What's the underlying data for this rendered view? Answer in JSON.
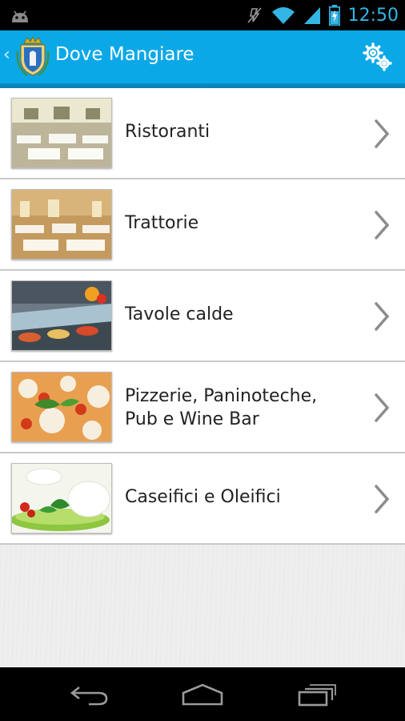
{
  "status_bar": {
    "time": "12:50",
    "icons": [
      "android-icon",
      "silent-icon",
      "wifi-icon",
      "signal-icon",
      "battery-charging-icon"
    ]
  },
  "action_bar": {
    "title": "Dove Mangiare",
    "back_glyph": "‹",
    "logo_icon": "coat-of-arms-icon",
    "settings_icon": "gears-icon"
  },
  "categories": [
    {
      "label_lines": [
        "Ristoranti"
      ],
      "thumb": "restaurant-interior"
    },
    {
      "label_lines": [
        "Trattorie"
      ],
      "thumb": "trattoria-interior"
    },
    {
      "label_lines": [
        "Tavole calde"
      ],
      "thumb": "buffet-counter"
    },
    {
      "label_lines": [
        "Pizzerie, Paninoteche,",
        "Pub e Wine Bar"
      ],
      "thumb": "pizza"
    },
    {
      "label_lines": [
        "Caseifici e Oleifici"
      ],
      "thumb": "mozzarella"
    }
  ],
  "nav_bar": {
    "icons": [
      "back-icon",
      "home-icon",
      "recent-apps-icon"
    ]
  },
  "colors": {
    "action_bar": "#0ba8e8",
    "status_accent": "#33b5e5",
    "list_bg": "#ffffff",
    "empty_bg": "#ececec"
  }
}
